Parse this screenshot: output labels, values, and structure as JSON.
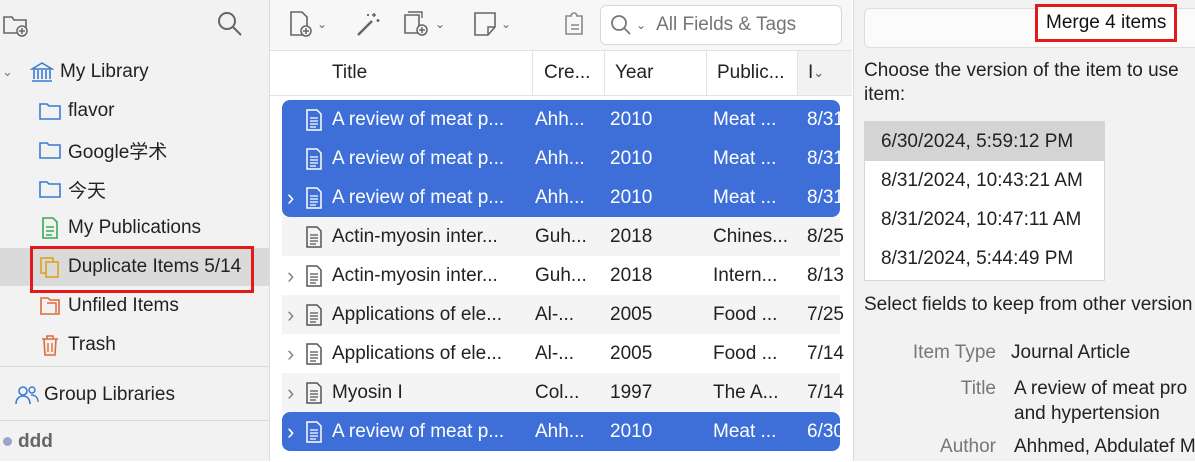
{
  "sidebar": {
    "items": [
      {
        "label": "My Library",
        "icon": "library-icon"
      },
      {
        "label": "flavor",
        "icon": "folder-icon"
      },
      {
        "label": "Google学术",
        "icon": "folder-icon"
      },
      {
        "label": "今天",
        "icon": "folder-icon"
      },
      {
        "label": "My Publications",
        "icon": "publications-icon"
      },
      {
        "label": "Duplicate Items 5/14",
        "icon": "duplicate-icon"
      },
      {
        "label": "Unfiled Items",
        "icon": "unfiled-icon"
      },
      {
        "label": "Trash",
        "icon": "trash-icon"
      }
    ],
    "group_libraries": "Group Libraries",
    "footer": "ddd"
  },
  "toolbar": {
    "search_placeholder": "All Fields & Tags"
  },
  "columns": [
    "Title",
    "Cre...",
    "Year",
    "Public...",
    "I"
  ],
  "rows": [
    {
      "title": "A review of meat p...",
      "creator": "Ahh...",
      "year": "2010",
      "publication": "Meat ...",
      "date": "8/31"
    },
    {
      "title": "A review of meat p...",
      "creator": "Ahh...",
      "year": "2010",
      "publication": "Meat ...",
      "date": "8/31"
    },
    {
      "title": "A review of meat p...",
      "creator": "Ahh...",
      "year": "2010",
      "publication": "Meat ...",
      "date": "8/31"
    },
    {
      "title": "Actin-myosin inter...",
      "creator": "Guh...",
      "year": "2018",
      "publication": "Chines...",
      "date": "8/25"
    },
    {
      "title": "Actin-myosin inter...",
      "creator": "Guh...",
      "year": "2018",
      "publication": "Intern...",
      "date": "8/13"
    },
    {
      "title": "Applications of ele...",
      "creator": "Al-...",
      "year": "2005",
      "publication": "Food ...",
      "date": "7/25"
    },
    {
      "title": "Applications of ele...",
      "creator": "Al-...",
      "year": "2005",
      "publication": "Food ...",
      "date": "7/14"
    },
    {
      "title": "Myosin I",
      "creator": "Col...",
      "year": "1997",
      "publication": "The A...",
      "date": "7/14"
    },
    {
      "title": "A review of meat p...",
      "creator": "Ahh...",
      "year": "2010",
      "publication": "Meat ...",
      "date": "6/30"
    }
  ],
  "merge": {
    "button_label": "Merge 4 items",
    "choose_text_1": "Choose the version of the item to use",
    "choose_text_2": "item:",
    "versions": [
      "6/30/2024, 5:59:12 PM",
      "8/31/2024, 10:43:21 AM",
      "8/31/2024, 10:47:11 AM",
      "8/31/2024, 5:44:49 PM"
    ],
    "select_fields_text": "Select fields to keep from other version",
    "fields": [
      {
        "label": "Item Type",
        "value": "Journal Article"
      },
      {
        "label": "Title",
        "value": "A review of meat pro",
        "value2": "and hypertension"
      },
      {
        "label": "Author",
        "value": "Ahhmed, Abdulatef M"
      }
    ]
  },
  "colors": {
    "selection": "#3e6fd9",
    "highlight_box": "#e01b1b",
    "folder": "#3a7bd5"
  }
}
